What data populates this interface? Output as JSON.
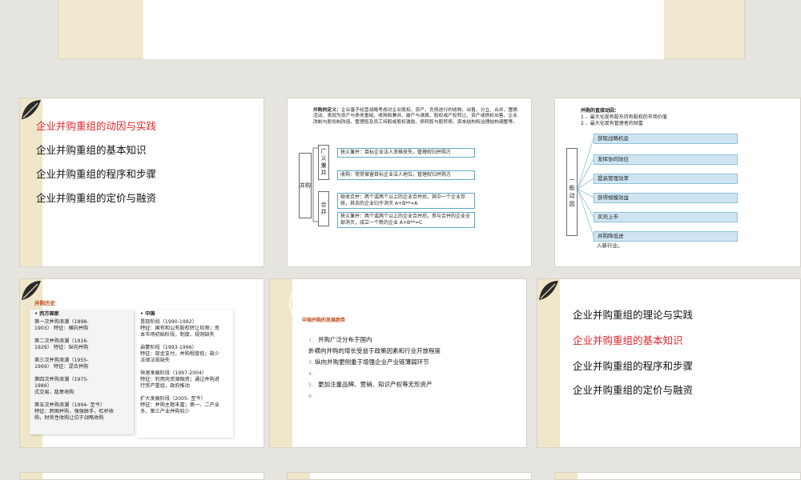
{
  "menu_items": [
    "企业并购重组的理论与实践",
    "企业并购重组的基本知识",
    "企业并购重组的程序和步骤",
    "企业并购重组的定价与融资"
  ],
  "slide1": {
    "items": [
      "企业并购重组的动因与实践",
      "企业并购重组的基本知识",
      "企业并购重组的程序和步骤",
      "企业并购重组的定价与融资"
    ],
    "active_index": 0
  },
  "slide2": {
    "def_label": "并购的定义：",
    "def_text": "企业基于经营战略考虑对企业股权、资产、负债进行的收购、出售、分立、合并、置换活动，表现为资产与债务重组、收购和兼并、破产与清算、股权或产权转让、资产或债权出售、企业改制与股份制改造、管理层及员工持股或股权激励、债转股与股转债、资本结构和治理结构调整等。",
    "root": "并购",
    "broad": "广义兼并",
    "merge": "合并",
    "boxes": [
      "狭义兼并：目标企业法人资格丧失，管理权归并购方",
      "收购：常常保留目标企业法人地位，管理权归并购方",
      "吸收合并：两个或两个以上的企业合并后，其中一个企业存续，其余的企业归于消灭 A+B**=A",
      "狭义兼并：两个或两个以上的企业合并后，参与合并的企业全部消灭，成立一个新的企业 A+B**=C"
    ]
  },
  "slide3": {
    "title": "并购的直接动因：",
    "lines": [
      "1 、最大化现有股东持有股权的市场价值",
      "2 、最大化现有管理者的财富"
    ],
    "left_label": "一般动因",
    "bars": [
      "获取战略机会",
      "发挥协同效应",
      "提高管理效率",
      "获得规模效益",
      "买壳上市",
      "并购降低进"
    ],
    "extra": "入新行业。"
  },
  "slide4": {
    "title": "并购历史",
    "west_header": "西方国家",
    "west_text": "第一次并购浪潮（1898-\n1903） 特征：横向并购\n\n第二次并购浪潮（1916-\n1929） 特征：纵向并购\n\n第三次并购浪潮（1955-\n1969） 特征：混合并购\n\n第四次并购浪潮（1975-\n1989）\n式交易，敌意收购\n\n第五次并购浪潮（1994- 至今）\n特征：跨国并购，强强联手，杠杆收\n购，财务性收购让位于战略收购",
    "china_header": "中国",
    "china_text": "昙现阶段（1990-1992）\n特征：国有和公有股权转让较频；资\n本市场初始阶段，制度、规则缺失\n\n启蒙阶段（1993-1996）\n特征：现金支付，并购程度低；缺少\n法律法规缺失\n\n快速发展阶段（1997-2004）\n特征：利用壳资源融资；通过并购进\n行资产重组，政府推动\n\n扩大发展阶段（2005- 至今）\n特征：并购主题丰富；第一、二产业\n多，第三产业并购较少"
  },
  "slide5": {
    "title": "中国并购的发展趋势",
    "items": [
      "并购广泛分布于国内",
      "外横向并购的增长受益于政策因素和行业开放程度",
      "纵向并购更侧重于增强企业产业链薄弱环节",
      "",
      "更加注重品牌、营销、知识产权等无形资产",
      ""
    ],
    "numbers": [
      "1.",
      "2.",
      "3.",
      "4.",
      "5.",
      "6."
    ]
  },
  "slide6": {
    "active_index": 1
  },
  "colors": {
    "accent_red": "#e0262b",
    "stripe": "#f0e6c9",
    "bar_blue": "#cfe6f2",
    "box_border": "#5fa8c2",
    "history_title": "#c04a1e"
  }
}
